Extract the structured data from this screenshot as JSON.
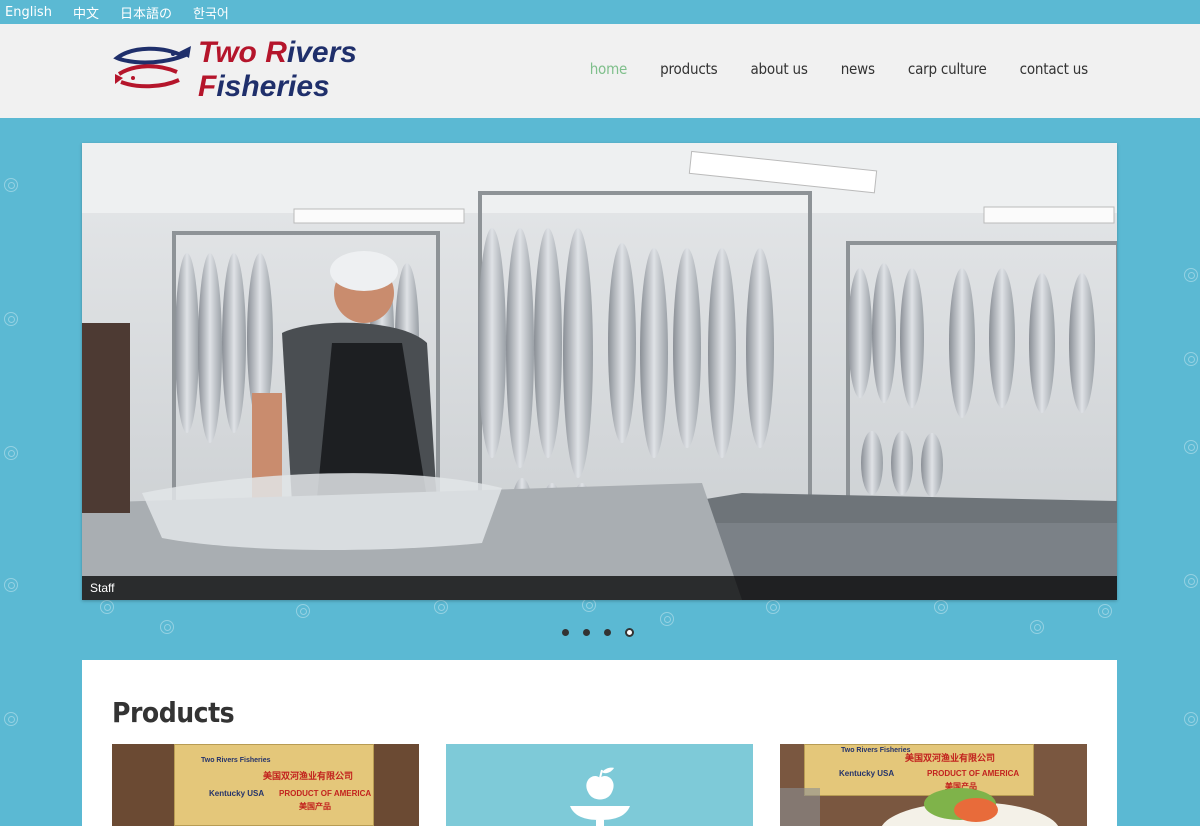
{
  "languages": [
    "English",
    "中文",
    "日本語の",
    "한국어"
  ],
  "logo": {
    "line1_a": "Two ",
    "line1_b": "R",
    "line1_c": "ivers",
    "line2_a": "F",
    "line2_b": "isheries"
  },
  "nav": [
    {
      "label": "home",
      "active": true
    },
    {
      "label": "products",
      "active": false
    },
    {
      "label": "about us",
      "active": false
    },
    {
      "label": "news",
      "active": false
    },
    {
      "label": "carp culture",
      "active": false
    },
    {
      "label": "contact us",
      "active": false
    }
  ],
  "slider": {
    "caption": "Staff",
    "slide_count": 4,
    "active_slide": 4
  },
  "products": {
    "title": "Products",
    "card1": {
      "brand": "Two Rivers Fisheries",
      "chinese": "美国双河渔业有限公司",
      "origin": "Kentucky USA",
      "label": "PRODUCT OF AMERICA",
      "sub": "美国产品"
    },
    "card3": {
      "brand": "Two Rivers Fisheries",
      "chinese": "美国双河渔业有限公司",
      "origin": "Kentucky USA",
      "label": "PRODUCT OF AMERICA",
      "sub": "美国产品"
    }
  },
  "colors": {
    "background": "#5bb9d3",
    "header": "#f1f1f1",
    "nav_active": "#7fbf8b",
    "logo_red": "#b5152b",
    "logo_blue": "#1f2f6b"
  }
}
